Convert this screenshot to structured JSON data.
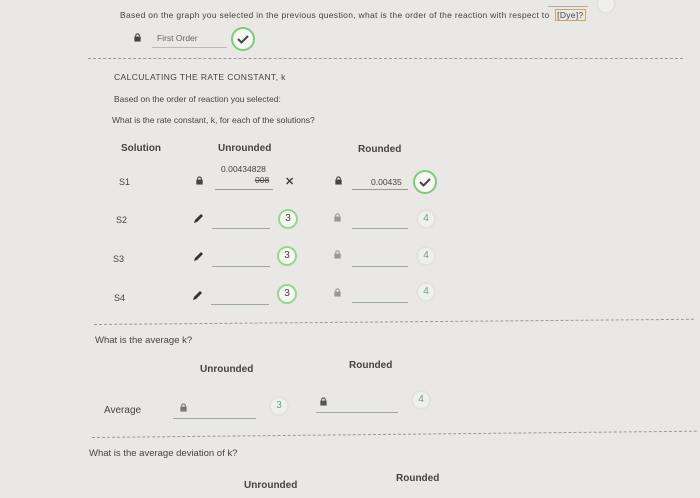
{
  "question": {
    "text": "Based on the graph you selected in the previous question, what is the order of the reaction with respect to",
    "dye": "[Dye]?",
    "answer": "First Order"
  },
  "section": {
    "title": "CALCULATING THE RATE CONSTANT, k",
    "line1": "Based on the order of reaction you selected:",
    "line2": "What is the rate constant, k, for each of the solutions?"
  },
  "table": {
    "col_solution": "Solution",
    "col_unrounded": "Unrounded",
    "col_rounded": "Rounded",
    "rows": [
      {
        "label": "S1",
        "unrounded_a": "0.00434828",
        "unrounded_b": "008",
        "sigfig": "",
        "rounded": "0.00435",
        "rounded_sigfig": ""
      },
      {
        "label": "S2",
        "unrounded_a": "",
        "unrounded_b": "",
        "sigfig": "3",
        "rounded": "",
        "rounded_sigfig": "4"
      },
      {
        "label": "S3",
        "unrounded_a": "",
        "unrounded_b": "",
        "sigfig": "3",
        "rounded": "",
        "rounded_sigfig": "4"
      },
      {
        "label": "S4",
        "unrounded_a": "",
        "unrounded_b": "",
        "sigfig": "3",
        "rounded": "",
        "rounded_sigfig": "4"
      }
    ]
  },
  "average": {
    "question": "What is the average k?",
    "unrounded_header": "Unrounded",
    "rounded_header": "Rounded",
    "row_label": "Average",
    "sigfig_unrounded": "3",
    "sigfig_rounded": "4"
  },
  "deviation": {
    "question": "What is the average deviation of k?",
    "unrounded_header": "Unrounded",
    "rounded_header": "Rounded"
  }
}
